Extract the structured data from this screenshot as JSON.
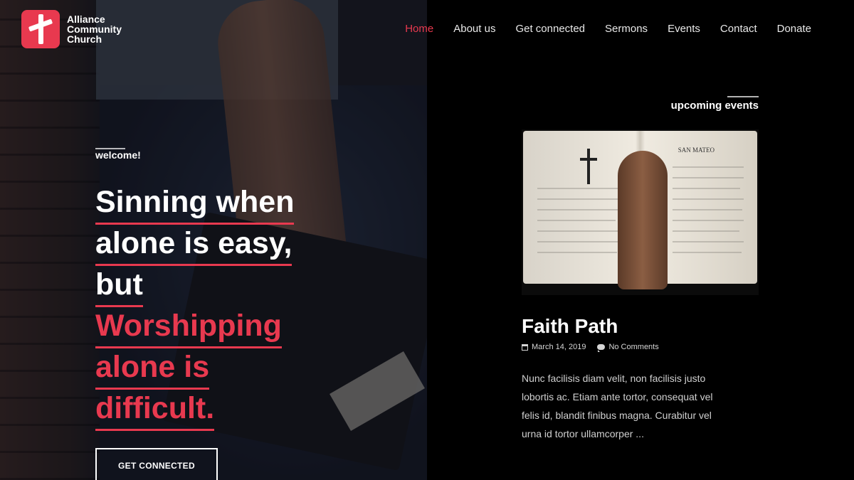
{
  "brand": {
    "name_line1": "Alliance",
    "name_line2": "Community",
    "name_line3": "Church",
    "accent_color": "#e8394f"
  },
  "nav": {
    "items": [
      {
        "label": "Home",
        "active": true
      },
      {
        "label": "About us",
        "active": false
      },
      {
        "label": "Get connected",
        "active": false
      },
      {
        "label": "Sermons",
        "active": false
      },
      {
        "label": "Events",
        "active": false
      },
      {
        "label": "Contact",
        "active": false
      },
      {
        "label": "Donate",
        "active": false
      }
    ]
  },
  "hero": {
    "kicker": "welcome!",
    "line1": "Sinning when",
    "line2": "alone is easy,",
    "line3": "but",
    "line4": "Worshipping",
    "line5": "alone is",
    "line6": "difficult.",
    "cta_label": "GET CONNECTED"
  },
  "events": {
    "heading": "upcoming events",
    "event": {
      "image_caption": "SAN MATEO",
      "title": "Faith Path",
      "date": "March 14, 2019",
      "comments": "No Comments",
      "excerpt": "Nunc facilisis diam velit, non facilisis justo lobortis ac. Etiam ante tortor, consequat vel felis id, blandit finibus magna. Curabitur vel urna id tortor ullamcorper ..."
    }
  }
}
